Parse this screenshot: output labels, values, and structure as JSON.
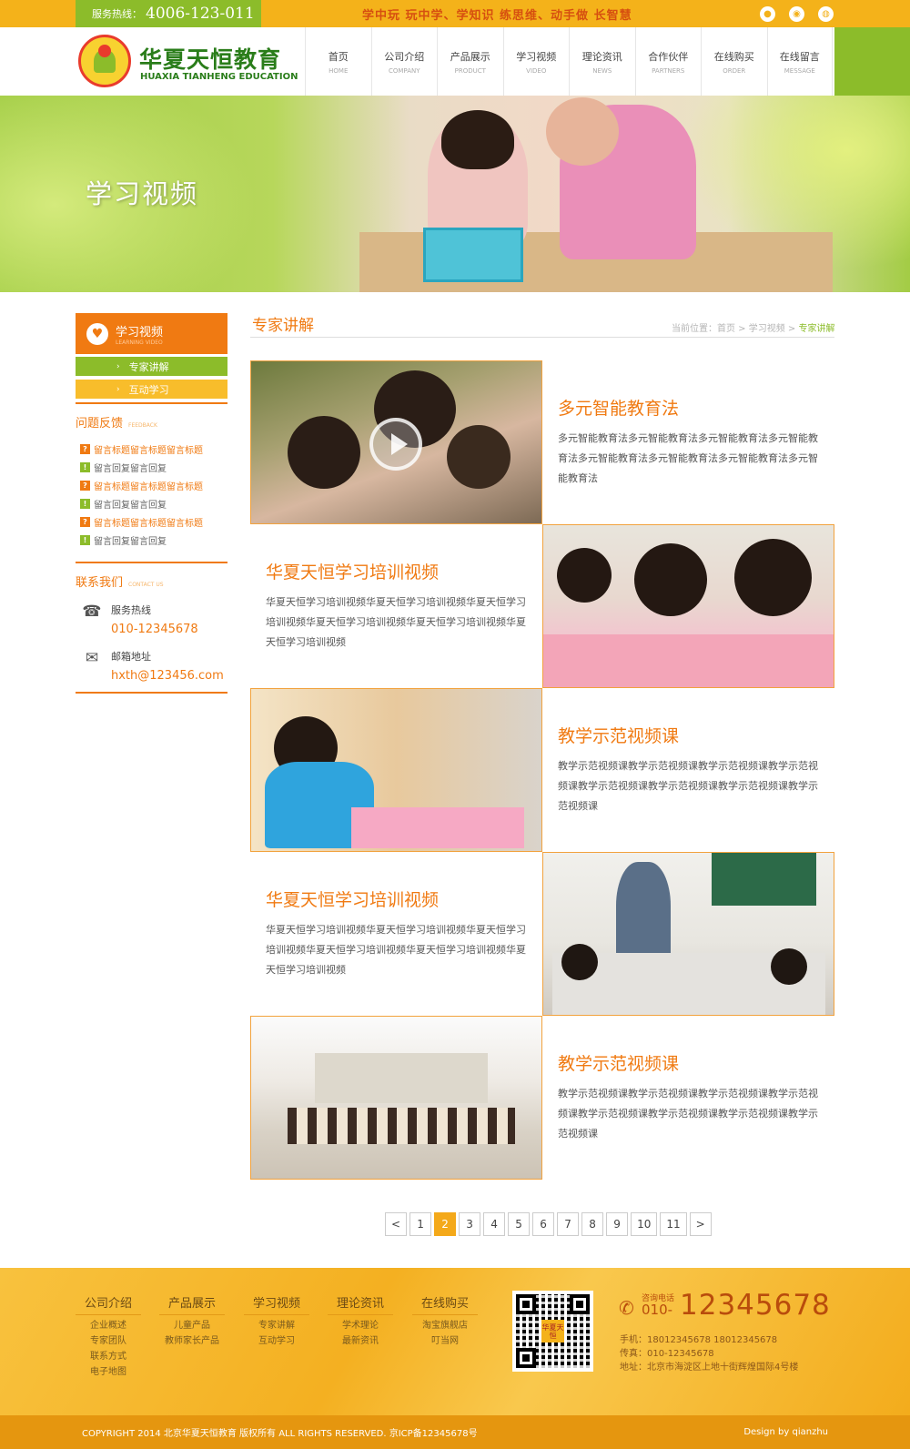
{
  "top": {
    "hotline_label": "服务热线：",
    "hotline_number": "4006-123-011",
    "slogan": "学中玩 玩中学、学知识 练思维、动手做 长智慧",
    "social_icons": [
      "qq-icon",
      "weibo-icon",
      "wechat-icon"
    ]
  },
  "brand": {
    "name_cn": "华夏天恒教育",
    "name_en": "HUAXIA TIANHENG EDUCATION"
  },
  "nav": [
    {
      "cn": "首页",
      "en": "HOME"
    },
    {
      "cn": "公司介绍",
      "en": "COMPANY"
    },
    {
      "cn": "产品展示",
      "en": "PRODUCT"
    },
    {
      "cn": "学习视频",
      "en": "VIDEO"
    },
    {
      "cn": "理论资讯",
      "en": "NEWS"
    },
    {
      "cn": "合作伙伴",
      "en": "PARTNERS"
    },
    {
      "cn": "在线购买",
      "en": "ORDER"
    },
    {
      "cn": "在线留言",
      "en": "MESSAGE"
    }
  ],
  "banner": {
    "title": "学习视频"
  },
  "sidebar": {
    "head_cn": "学习视频",
    "head_en": "LEARNING VIDEO",
    "menu": [
      "专家讲解",
      "互动学习"
    ],
    "feedback_title": "问题反馈",
    "feedback_en": "FEEDBACK",
    "feedback": [
      "留言标题留言标题留言标题",
      "留言回复留言回复",
      "留言标题留言标题留言标题",
      "留言回复留言回复",
      "留言标题留言标题留言标题",
      "留言回复留言回复"
    ],
    "contact_title": "联系我们",
    "contact_en": "CONTACT US",
    "hotline_label": "服务热线",
    "hotline": "010-12345678",
    "email_label": "邮箱地址",
    "email": "hxth@123456.com"
  },
  "main": {
    "title": "专家讲解",
    "breadcrumb_prefix": "当前位置：首页 > 学习视频 > ",
    "breadcrumb_current": "专家讲解",
    "items": [
      {
        "title": "多元智能教育法",
        "desc": "多元智能教育法多元智能教育法多元智能教育法多元智能教育法多元智能教育法多元智能教育法多元智能教育法多元智能教育法"
      },
      {
        "title": "华夏天恒学习培训视频",
        "desc": "华夏天恒学习培训视频华夏天恒学习培训视频华夏天恒学习培训视频华夏天恒学习培训视频华夏天恒学习培训视频华夏天恒学习培训视频"
      },
      {
        "title": "教学示范视频课",
        "desc": "教学示范视频课教学示范视频课教学示范视频课教学示范视频课教学示范视频课教学示范视频课教学示范视频课教学示范视频课"
      },
      {
        "title": "华夏天恒学习培训视频",
        "desc": "华夏天恒学习培训视频华夏天恒学习培训视频华夏天恒学习培训视频华夏天恒学习培训视频华夏天恒学习培训视频华夏天恒学习培训视频"
      },
      {
        "title": "教学示范视频课",
        "desc": "教学示范视频课教学示范视频课教学示范视频课教学示范视频课教学示范视频课教学示范视频课教学示范视频课教学示范视频课"
      }
    ]
  },
  "pager": {
    "prev": "<",
    "pages": [
      "1",
      "2",
      "3",
      "4",
      "5",
      "6",
      "7",
      "8",
      "9",
      "10",
      "11"
    ],
    "current": "2",
    "next": ">"
  },
  "footer": {
    "cols": [
      {
        "head": "公司介绍",
        "links": [
          "企业概述",
          "专家团队",
          "联系方式",
          "电子地图"
        ]
      },
      {
        "head": "产品展示",
        "links": [
          "儿童产品",
          "教师家长产品"
        ]
      },
      {
        "head": "学习视频",
        "links": [
          "专家讲解",
          "互动学习"
        ]
      },
      {
        "head": "理论资讯",
        "links": [
          "学术理论",
          "最新资讯"
        ]
      },
      {
        "head": "在线购买",
        "links": [
          "淘宝旗舰店",
          "叮当网"
        ]
      }
    ],
    "qr_tag": "华夏天恒",
    "phone_label": "咨询电话",
    "phone_prefix": "010-",
    "phone_number": "12345678",
    "mobile": "手机：18012345678  18012345678",
    "fax": "传真：010-12345678",
    "address": "地址：北京市海淀区上地十街辉煌国际4号楼",
    "copyright": "COPYRIGHT 2014 北京华夏天恒教育 版权所有 ALL RIGHTS RESERVED.   京ICP备12345678号",
    "design": "Design by qianzhu"
  },
  "colors": {
    "orange": "#f07a12",
    "green": "#8cbc2a",
    "yellow": "#f4b21a"
  }
}
